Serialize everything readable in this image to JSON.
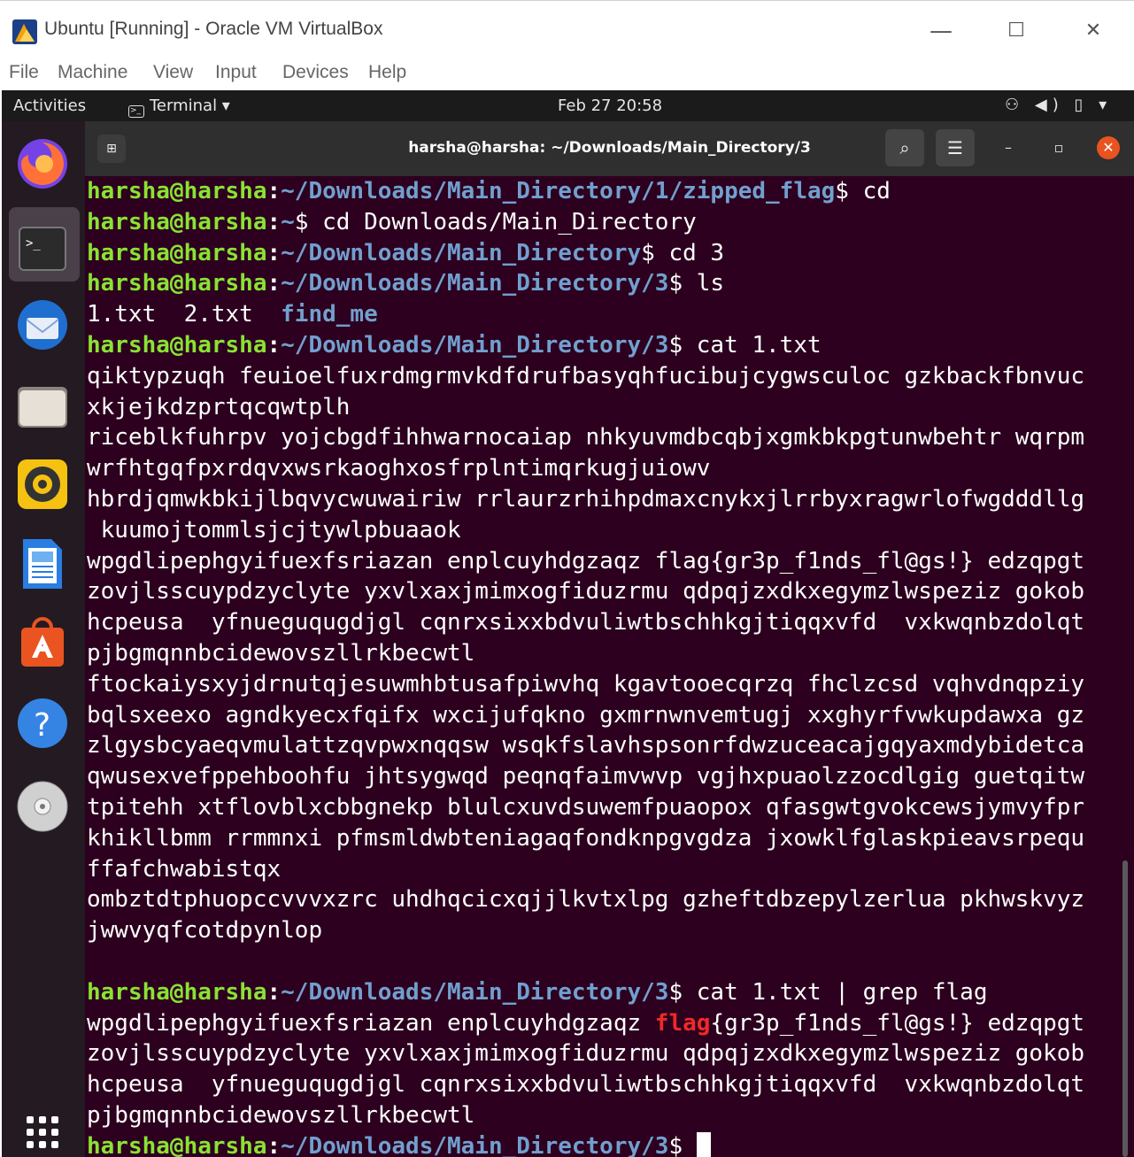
{
  "window": {
    "title": "Ubuntu [Running] - Oracle VM VirtualBox",
    "controls": {
      "minimize": "—",
      "maximize": "☐",
      "close": "✕"
    }
  },
  "menubar": [
    "File",
    "Machine",
    "View",
    "Input",
    "Devices",
    "Help"
  ],
  "topbar": {
    "activities": "Activities",
    "app_menu": "Terminal ▾",
    "clock": "Feb 27  20:58",
    "tray": "⚇ ◀) ▯ ▾"
  },
  "dock": {
    "items": [
      "firefox-icon",
      "terminal-icon",
      "thunderbird-icon",
      "files-icon",
      "rhythmbox-icon",
      "libreoffice-writer-icon",
      "software-center-icon",
      "help-icon",
      "dvd-icon",
      "show-apps-icon"
    ],
    "colors": {
      "firefox": "#ff7139",
      "thunderbird": "#1f6fd0",
      "files": "#e6e0d6",
      "rhythmbox": "#f5c211",
      "writer": "#2a7de1",
      "software": "#e95420",
      "help": "#3584e4",
      "dvd": "#d0d0d0"
    }
  },
  "terminal": {
    "title": "harsha@harsha: ~/Downloads/Main_Directory/3",
    "new_tab": "⊞",
    "search": "⌕",
    "menu": "☰",
    "minimize": "–",
    "restore": "▫",
    "close": "✕",
    "prompt_user": "harsha@harsha",
    "prompt_colon": ":",
    "lines": [
      {
        "type": "prompt",
        "path": "~/Downloads/Main_Directory/1/zipped_flag",
        "cmd": "$ cd"
      },
      {
        "type": "prompt",
        "path": "~",
        "cmd": "$ cd Downloads/Main_Directory"
      },
      {
        "type": "prompt",
        "path": "~/Downloads/Main_Directory",
        "cmd": "$ cd 3"
      },
      {
        "type": "prompt",
        "path": "~/Downloads/Main_Directory/3",
        "cmd": "$ ls"
      },
      {
        "type": "ls",
        "files": "1.txt  2.txt  ",
        "dir": "find_me"
      },
      {
        "type": "prompt",
        "path": "~/Downloads/Main_Directory/3",
        "cmd": "$ cat 1.txt"
      },
      {
        "type": "text",
        "text": "qiktypzuqh feuioelfuxrdmgrmvkdfdrufbasyqhfucibujcygwsculoc gzkbackfbnvuc"
      },
      {
        "type": "text",
        "text": "xkjejkdzprtqcqwtplh"
      },
      {
        "type": "text",
        "text": "riceblkfuhrpv yojcbgdfihhwarnocaiap nhkyuvmdbcqbjxgmkbkpgtunwbehtr wqrpm"
      },
      {
        "type": "text",
        "text": "wrfhtgqfpxrdqvxwsrkaoghxosfrplntimqrkugjuiowv"
      },
      {
        "type": "text",
        "text": "hbrdjqmwkbkijlbqvycwuwairiw rrlaurzrhihpdmaxcnykxjlrrbyxragwrlofwgdddllg"
      },
      {
        "type": "text",
        "text": " kuumojtommlsjcjtywlpbuaaok"
      },
      {
        "type": "text",
        "text": "wpgdlipephgyifuexfsriazan enplcuyhdgzaqz flag{gr3p_f1nds_fl@gs!} edzqpgt"
      },
      {
        "type": "text",
        "text": "zovjlsscuypdzyclyte yxvlxaxjmimxogfiduzrmu qdpqjzxdkxegymzlwspeziz gokob"
      },
      {
        "type": "text",
        "text": "hcpeusa  yfnueguqugdjgl cqnrxsixxbdvuliwtbschhkgjtiqqxvfd  vxkwqnbzdolqt"
      },
      {
        "type": "text",
        "text": "pjbgmqnnbcidewovszllrkbecwtl"
      },
      {
        "type": "text",
        "text": "ftockaiysxyjdrnutqjesuwmhbtusafpiwvhq kgavtooecqrzq fhclzcsd vqhvdnqpziy"
      },
      {
        "type": "text",
        "text": "bqlsxeexo agndkyecxfqifx wxcijufqkno gxmrnwnvemtugj xxghyrfvwkupdawxa gz"
      },
      {
        "type": "text",
        "text": "zlgysbcyaeqvmulattzqvpwxnqqsw wsqkfslavhspsonrfdwzuceacajgqyaxmdybidetca"
      },
      {
        "type": "text",
        "text": "qwusexvefppehboohfu jhtsygwqd peqnqfaimvwvp vgjhxpuaolzzocdlgig guetqitw"
      },
      {
        "type": "text",
        "text": "tpitehh xtflovblxcbbgnekp blulcxuvdsuwemfpuaopox qfasgwtgvokcewsjymvyfpr"
      },
      {
        "type": "text",
        "text": "khikllbmm rrmmnxi pfmsmldwbteniagaqfondknpgvgdza jxowklfglaskpieavsrpequ"
      },
      {
        "type": "text",
        "text": "ffafchwabistqx"
      },
      {
        "type": "text",
        "text": "ombztdtphuopccvvvxzrc uhdhqcicxqjjlkvtxlpg gzheftdbzepylzerlua pkhwskvyz"
      },
      {
        "type": "text",
        "text": "jwwvyqfcotdpynlop"
      },
      {
        "type": "text",
        "text": ""
      },
      {
        "type": "prompt",
        "path": "~/Downloads/Main_Directory/3",
        "cmd": "$ cat 1.txt | grep flag"
      },
      {
        "type": "grep",
        "before": "wpgdlipephgyifuexfsriazan enplcuyhdgzaqz ",
        "match": "flag",
        "after": "{gr3p_f1nds_fl@gs!} edzqpgt"
      },
      {
        "type": "text",
        "text": "zovjlsscuypdzyclyte yxvlxaxjmimxogfiduzrmu qdpqjzxdkxegymzlwspeziz gokob"
      },
      {
        "type": "text",
        "text": "hcpeusa  yfnueguqugdjgl cqnrxsixxbdvuliwtbschhkgjtiqqxvfd  vxkwqnbzdolqt"
      },
      {
        "type": "text",
        "text": "pjbgmqnnbcidewovszllrkbecwtl"
      },
      {
        "type": "final",
        "path": "~/Downloads/Main_Directory/3",
        "cmd": "$ "
      }
    ]
  }
}
